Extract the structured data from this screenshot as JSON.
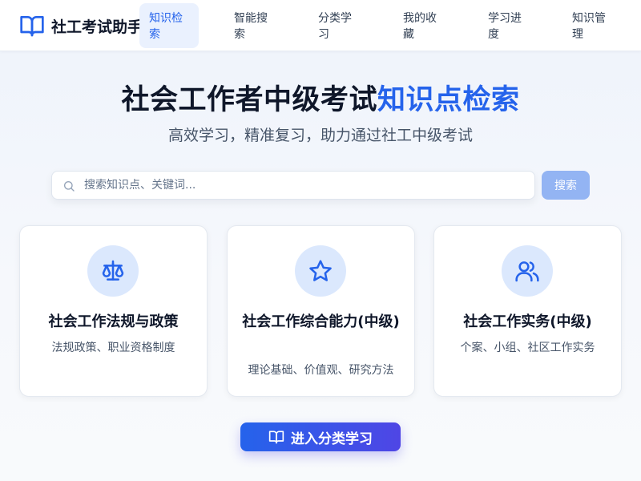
{
  "header": {
    "brand": {
      "title": "社工考试助手",
      "icon": "book-open-icon"
    },
    "nav": [
      {
        "label": "知识检索",
        "active": true
      },
      {
        "label": "智能搜索",
        "active": false
      },
      {
        "label": "分类学习",
        "active": false
      },
      {
        "label": "我的收藏",
        "active": false
      },
      {
        "label": "学习进度",
        "active": false
      },
      {
        "label": "知识管理",
        "active": false
      }
    ]
  },
  "hero": {
    "title_main": "社会工作者中级考试",
    "title_accent": "知识点检索",
    "subtitle": "高效学习，精准复习，助力通过社工中级考试"
  },
  "search": {
    "placeholder": "搜索知识点、关键词...",
    "value": "",
    "button_label": "搜索",
    "icon": "search-icon"
  },
  "categories": [
    {
      "title": "社会工作法规与政策",
      "desc": "法规政策、职业资格制度",
      "icon": "scale-icon"
    },
    {
      "title": "社会工作综合能力(中级)",
      "desc": "理论基础、价值观、研究方法",
      "icon": "star-icon"
    },
    {
      "title": "社会工作实务(中级)",
      "desc": "个案、小组、社区工作实务",
      "icon": "users-icon"
    }
  ],
  "cta": {
    "label": "进入分类学习",
    "icon": "book-open-icon"
  },
  "colors": {
    "accent": "#2563eb",
    "accent_end": "#4f46e5",
    "icon_bg": "#dbe8fd",
    "search_button": "#93b4f3"
  }
}
